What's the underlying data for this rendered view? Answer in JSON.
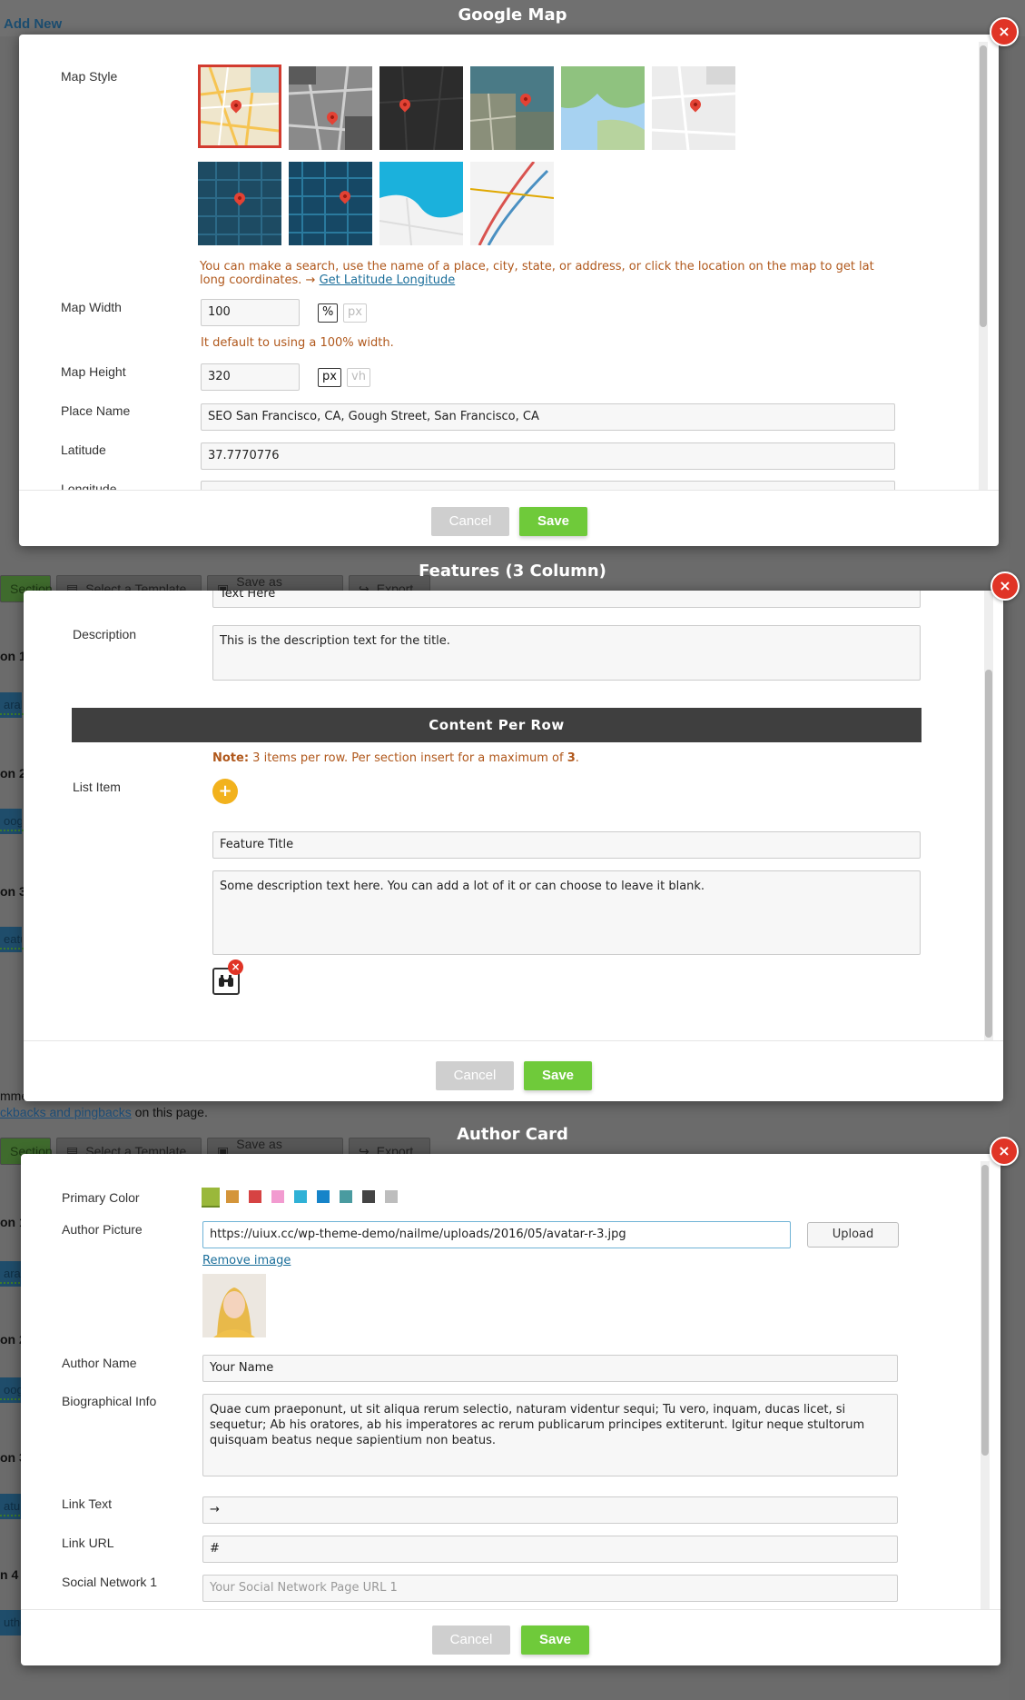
{
  "background": {
    "add_new": "Add New",
    "trackbacks_prefix": "mme",
    "trackbacks_link": "ckbacks and pingbacks",
    "trackbacks_suffix": " on this page.",
    "toolbar": {
      "section": "Section",
      "select_template": "Select a Template",
      "save_as_template": "Save as Template",
      "export": "Export"
    },
    "toolbar2": {
      "section": "Section",
      "select_template": "Select a Template",
      "save_as_template": "Save as Template",
      "export": "Export"
    },
    "sections": [
      "on 1",
      "on 2",
      "on 3",
      "on 1",
      "on 2",
      "on 3",
      "n 4"
    ],
    "chips": [
      "arall",
      "oogl",
      "eatur",
      "arall",
      "oogl",
      "atur",
      "uthor"
    ]
  },
  "google_map": {
    "title": "Google Map",
    "close": "×",
    "map_style_label": "Map Style",
    "styles": [
      "default",
      "grayscale",
      "dark",
      "satellite",
      "terrain",
      "light",
      "blueprint-pins",
      "blueprint-grid",
      "aqua",
      "transit"
    ],
    "selected_style": "default",
    "hint_text": "You can make a search, use the name of a place, city, state, or address, or click the location on the map to get lat long coordinates. → ",
    "hint_link": "Get Latitude Longitude",
    "width_label": "Map Width",
    "width_value": "100",
    "width_unit_active": "%",
    "width_unit_inactive": "px",
    "width_note": "It default to using a 100% width.",
    "height_label": "Map Height",
    "height_value": "320",
    "height_unit_active": "px",
    "height_unit_inactive": "vh",
    "place_label": "Place Name",
    "place_value": "SEO San Francisco, CA, Gough Street, San Francisco, CA",
    "lat_label": "Latitude",
    "lat_value": "37.7770776",
    "lng_label": "Longitude",
    "cancel": "Cancel",
    "save": "Save"
  },
  "features": {
    "title": "Features (3 Column)",
    "close": "×",
    "top_input_value": "Text Here",
    "desc_label": "Description",
    "desc_value": "This is the description text for the title.",
    "section_title": "Content Per Row",
    "note_label": "Note:",
    "note_text_a": " 3 items per row. Per section insert for a maximum of ",
    "note_max": "3",
    "note_end": ".",
    "list_label": "List Item",
    "add": "+",
    "feature_title_value": "Feature Title",
    "feature_desc_value": "Some description text here. You can add a lot of it or can choose to leave it blank.",
    "icon_remove": "×",
    "cancel": "Cancel",
    "save": "Save"
  },
  "author": {
    "title": "Author Card",
    "close": "×",
    "color_label": "Primary Color",
    "colors": [
      "#9ab83b",
      "#d4953a",
      "#d64343",
      "#f29bd0",
      "#2fb1d6",
      "#1684c9",
      "#4a9ba0",
      "#444444",
      "#bdbdbd"
    ],
    "selected_color": "#9ab83b",
    "picture_label": "Author Picture",
    "picture_url": "https://uiux.cc/wp-theme-demo/nailme/uploads/2016/05/avatar-r-3.jpg",
    "upload": "Upload",
    "remove_image": "Remove image",
    "name_label": "Author Name",
    "name_value": "Your Name",
    "bio_label": "Biographical Info",
    "bio_value": "Quae cum praeponunt, ut sit aliqua rerum selectio, naturam videntur sequi; Tu vero, inquam, ducas licet, si sequetur; Ab his oratores, ab his imperatores ac rerum publicarum principes extiterunt. Igitur neque stultorum quisquam beatus neque sapientium non beatus.",
    "link_text_label": "Link Text",
    "link_text_value": "→",
    "link_url_label": "Link URL",
    "link_url_value": "#",
    "social_label": "Social Network 1",
    "social_placeholder": "Your Social Network Page URL 1",
    "cancel": "Cancel",
    "save": "Save"
  }
}
